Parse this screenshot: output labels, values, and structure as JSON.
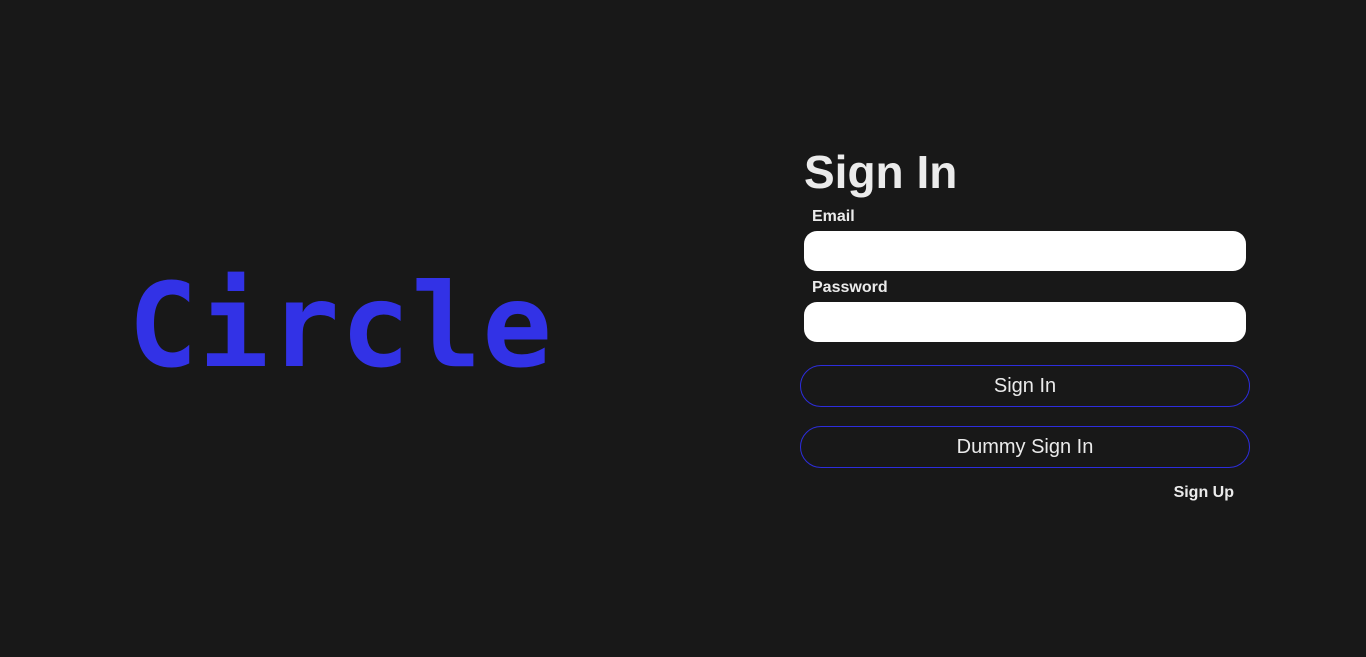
{
  "brand": {
    "name": "Circle",
    "color": "#3232e6"
  },
  "form": {
    "title": "Sign In",
    "email": {
      "label": "Email",
      "value": "",
      "placeholder": ""
    },
    "password": {
      "label": "Password",
      "value": "",
      "placeholder": ""
    },
    "sign_in_label": "Sign In",
    "dummy_sign_in_label": "Dummy Sign In",
    "sign_up_label": "Sign Up"
  },
  "colors": {
    "background": "#181818",
    "accent": "#2d2ddc",
    "text": "#ebebeb",
    "input_background": "#ffffff"
  }
}
